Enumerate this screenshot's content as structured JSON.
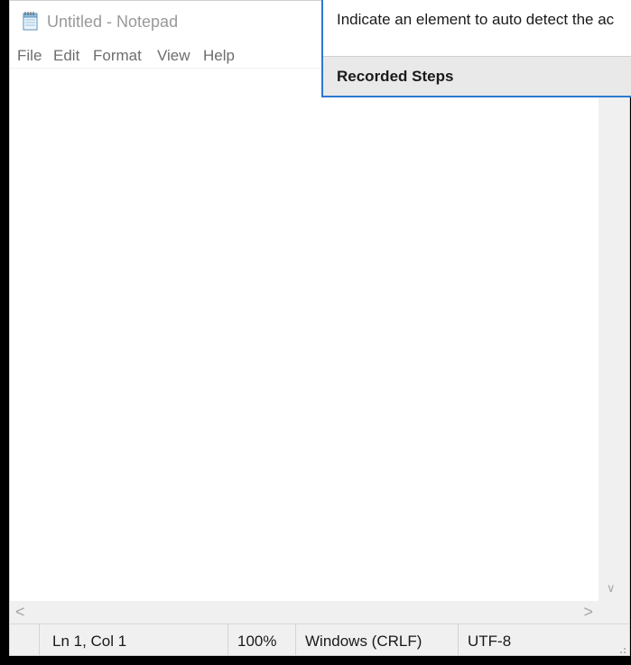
{
  "window": {
    "title": "Untitled - Notepad",
    "icon": "notepad-icon"
  },
  "menu": {
    "items": [
      {
        "label": "File"
      },
      {
        "label": "Edit"
      },
      {
        "label": "Format"
      },
      {
        "label": "View"
      },
      {
        "label": "Help"
      }
    ]
  },
  "editor": {
    "content": ""
  },
  "statusbar": {
    "position": "Ln 1, Col 1",
    "zoom": "100%",
    "line_endings": "Windows (CRLF)",
    "encoding": "UTF-8"
  },
  "popup": {
    "instruction": "Indicate an element to auto detect the ac",
    "footer_label": "Recorded Steps"
  },
  "colors": {
    "accent_border": "#2b79d1",
    "status_bg": "#f0f0f0"
  }
}
